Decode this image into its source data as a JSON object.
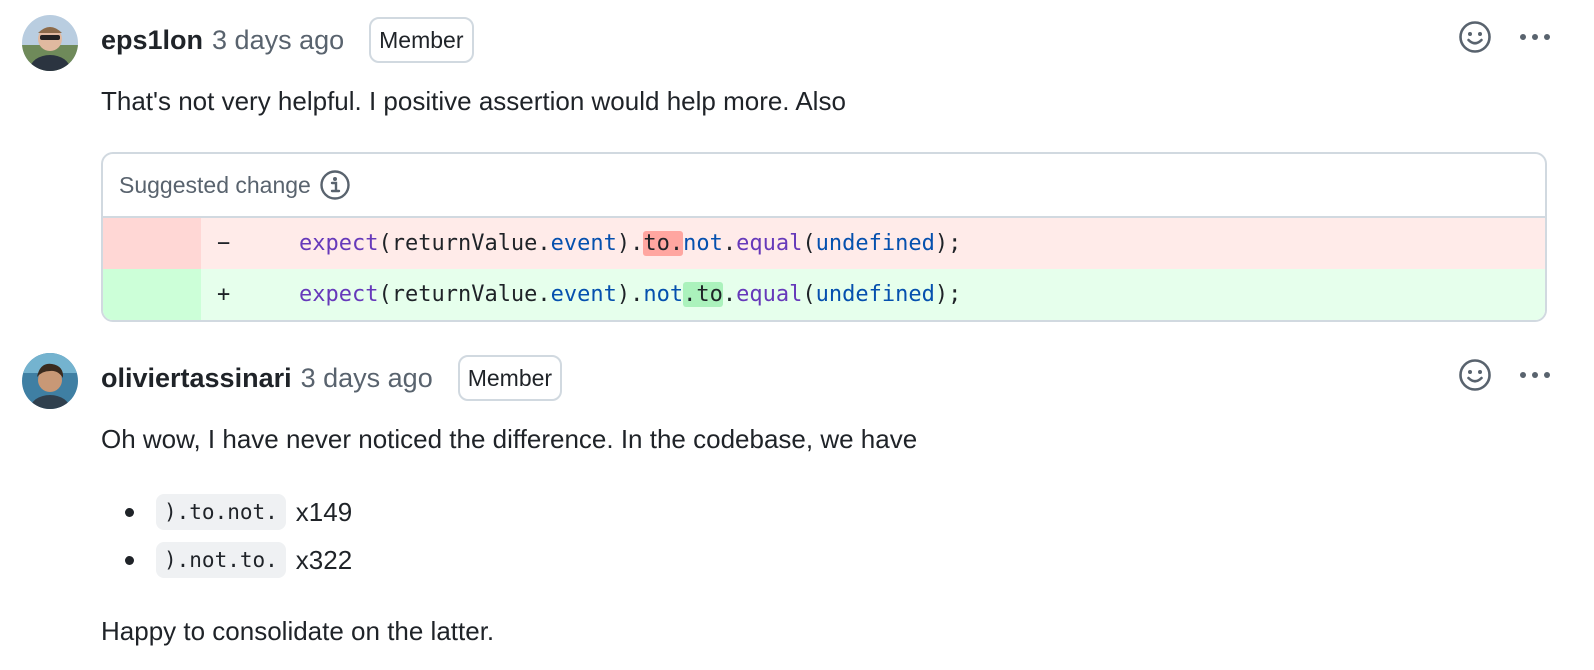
{
  "comments": [
    {
      "author": "eps1lon",
      "time": "3 days ago",
      "badge": "Member",
      "body": "That's not very helpful. I positive assertion would help more. Also",
      "suggestion": {
        "title": "Suggested change",
        "removed": {
          "marker": "−",
          "tokens": [
            "expect",
            "(returnValue.",
            "event",
            ").",
            "to.",
            "not",
            ".",
            "equal",
            "(",
            "undefined",
            ");"
          ]
        },
        "added": {
          "marker": "+",
          "tokens": [
            "expect",
            "(returnValue.",
            "event",
            ").",
            "not",
            ".to",
            ".",
            "equal",
            "(",
            "undefined",
            ");"
          ]
        }
      }
    },
    {
      "author": "oliviertassinari",
      "time": "3 days ago",
      "badge": "Member",
      "body": "Oh wow, I have never noticed the difference. In the codebase, we have",
      "bullets": [
        {
          "code": ").to.not.",
          "count": "x149"
        },
        {
          "code": ").not.to.",
          "count": "x322"
        }
      ],
      "closing": "Happy to consolidate on the latter."
    }
  ],
  "icons": {
    "reaction": "smiley-icon",
    "more": "kebab-horizontal-icon",
    "info": "info-icon"
  },
  "colors": {
    "text": "#1f2328",
    "muted": "#59636e",
    "border": "#d1d9e0",
    "diff_del_bg": "#ffebe9",
    "diff_del_highlight": "#ffa6a0",
    "diff_add_bg": "#e6ffec",
    "diff_add_highlight": "#abf2bc",
    "syntax_function": "#6639ba",
    "syntax_property": "#0550ae"
  }
}
